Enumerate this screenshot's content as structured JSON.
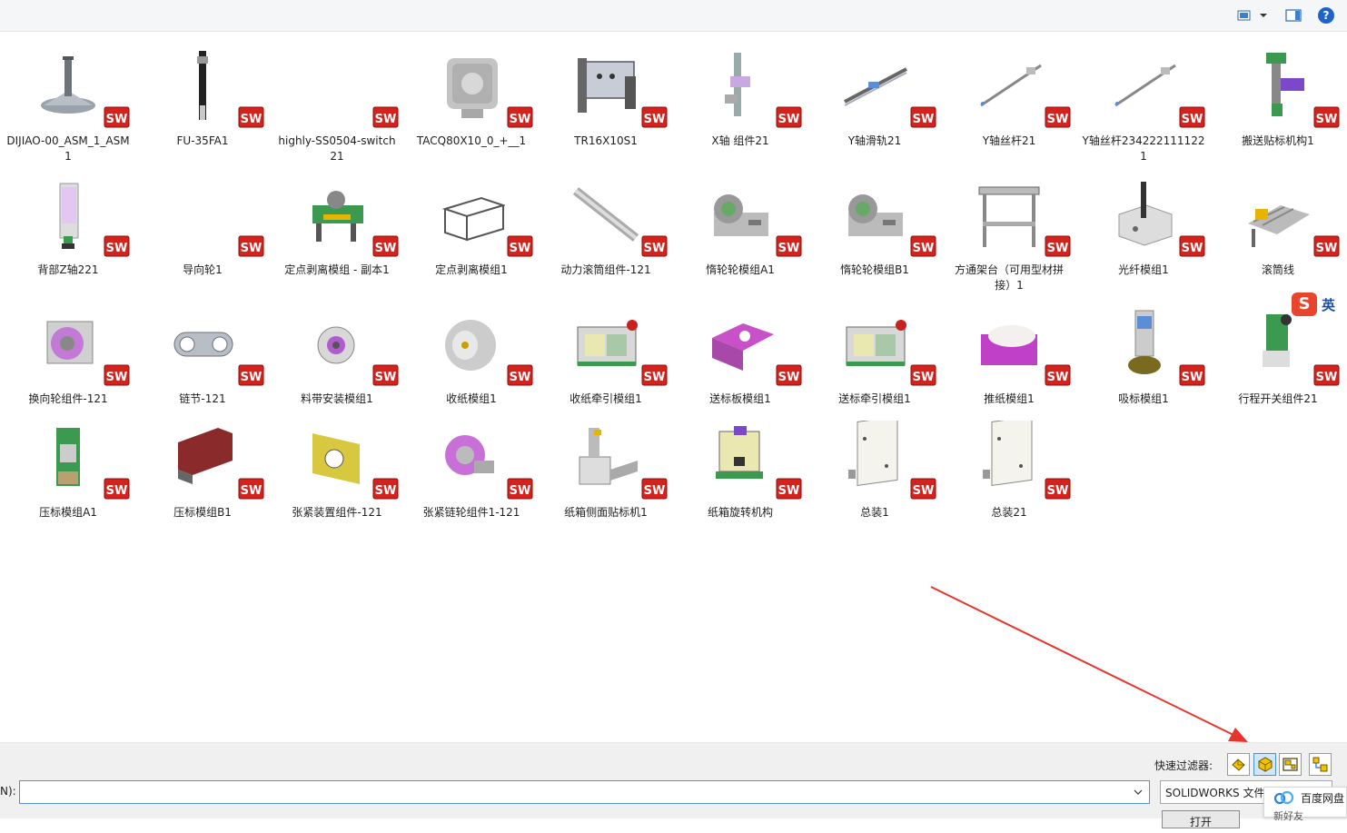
{
  "toolbar": {
    "view_icon": "view-menu-icon",
    "pane_icon": "preview-pane-icon",
    "help_label": "?"
  },
  "files": [
    {
      "name": "DIJIAO-00_ASM_1_ASM1",
      "thumb": "leveling-foot"
    },
    {
      "name": "FU-35FA1",
      "thumb": "sensor-rod"
    },
    {
      "name": "highly-SS0504-switch21",
      "thumb": "none"
    },
    {
      "name": "TACQ80X10_0_+__1",
      "thumb": "cylinder-block"
    },
    {
      "name": "TR16X10S1",
      "thumb": "slide-cylinder"
    },
    {
      "name": "X轴 组件21",
      "thumb": "vertical-axis"
    },
    {
      "name": "Y轴滑轨21",
      "thumb": "rail"
    },
    {
      "name": "Y轴丝杆21",
      "thumb": "screw"
    },
    {
      "name": "Y轴丝杆2342221111221",
      "thumb": "screw"
    },
    {
      "name": "搬送贴标机构1",
      "thumb": "mechanism-green"
    },
    {
      "name": "背部Z轴221",
      "thumb": "z-axis"
    },
    {
      "name": "导向轮1",
      "thumb": "none"
    },
    {
      "name": "定点剥离模组 - 副本1",
      "thumb": "peel-module"
    },
    {
      "name": "定点剥离模组1",
      "thumb": "frame-box"
    },
    {
      "name": "动力滚筒组件-121",
      "thumb": "roller"
    },
    {
      "name": "惰轮轮模组A1",
      "thumb": "idler"
    },
    {
      "name": "惰轮轮模组B1",
      "thumb": "idler"
    },
    {
      "name": "方通架台（可用型材拼接）1",
      "thumb": "table"
    },
    {
      "name": "光纤模组1",
      "thumb": "bracket"
    },
    {
      "name": "滚筒线",
      "thumb": "conveyor"
    },
    {
      "name": "换向轮组件-121",
      "thumb": "wheel-block"
    },
    {
      "name": "链节-121",
      "thumb": "chain"
    },
    {
      "name": "料带安装模组1",
      "thumb": "reel"
    },
    {
      "name": "收纸模组1",
      "thumb": "drum"
    },
    {
      "name": "收纸牵引模组1",
      "thumb": "traction"
    },
    {
      "name": "送标板模组1",
      "thumb": "purple-plate"
    },
    {
      "name": "送标牵引模组1",
      "thumb": "traction"
    },
    {
      "name": "推纸模组1",
      "thumb": "purple-roller"
    },
    {
      "name": "吸标模组1",
      "thumb": "suction"
    },
    {
      "name": "行程开关组件21",
      "thumb": "switch-green"
    },
    {
      "name": "压标模组A1",
      "thumb": "press"
    },
    {
      "name": "压标模组B1",
      "thumb": "brown-plate"
    },
    {
      "name": "张紧装置组件-121",
      "thumb": "yellow-plate"
    },
    {
      "name": "张紧链轮组件1-121",
      "thumb": "sprocket"
    },
    {
      "name": "纸箱侧面贴标机1",
      "thumb": "machine"
    },
    {
      "name": "纸箱旋转机构",
      "thumb": "rotary"
    },
    {
      "name": "总装1",
      "thumb": "assembly"
    },
    {
      "name": "总装21",
      "thumb": "assembly"
    }
  ],
  "badge_label": "SW",
  "bottom": {
    "quick_filter_label": "快速过滤器:",
    "filters": [
      {
        "icon": "part-filter-icon"
      },
      {
        "icon": "assembly-filter-icon"
      },
      {
        "icon": "drawing-filter-icon"
      },
      {
        "icon": "toplevel-assembly-filter-icon"
      }
    ],
    "filename_label": "N):",
    "filename_value": "",
    "filetype_value": "SOLIDWORKS 文件",
    "open_label": "打开"
  },
  "baidu": {
    "label": "百度网盘",
    "sub": "新好友"
  },
  "ime": {
    "logo": "S",
    "lang": "英"
  },
  "colors": {
    "accent": "#1e64c8",
    "badge_red": "#d6221c",
    "arrow_red": "#e8352c"
  }
}
